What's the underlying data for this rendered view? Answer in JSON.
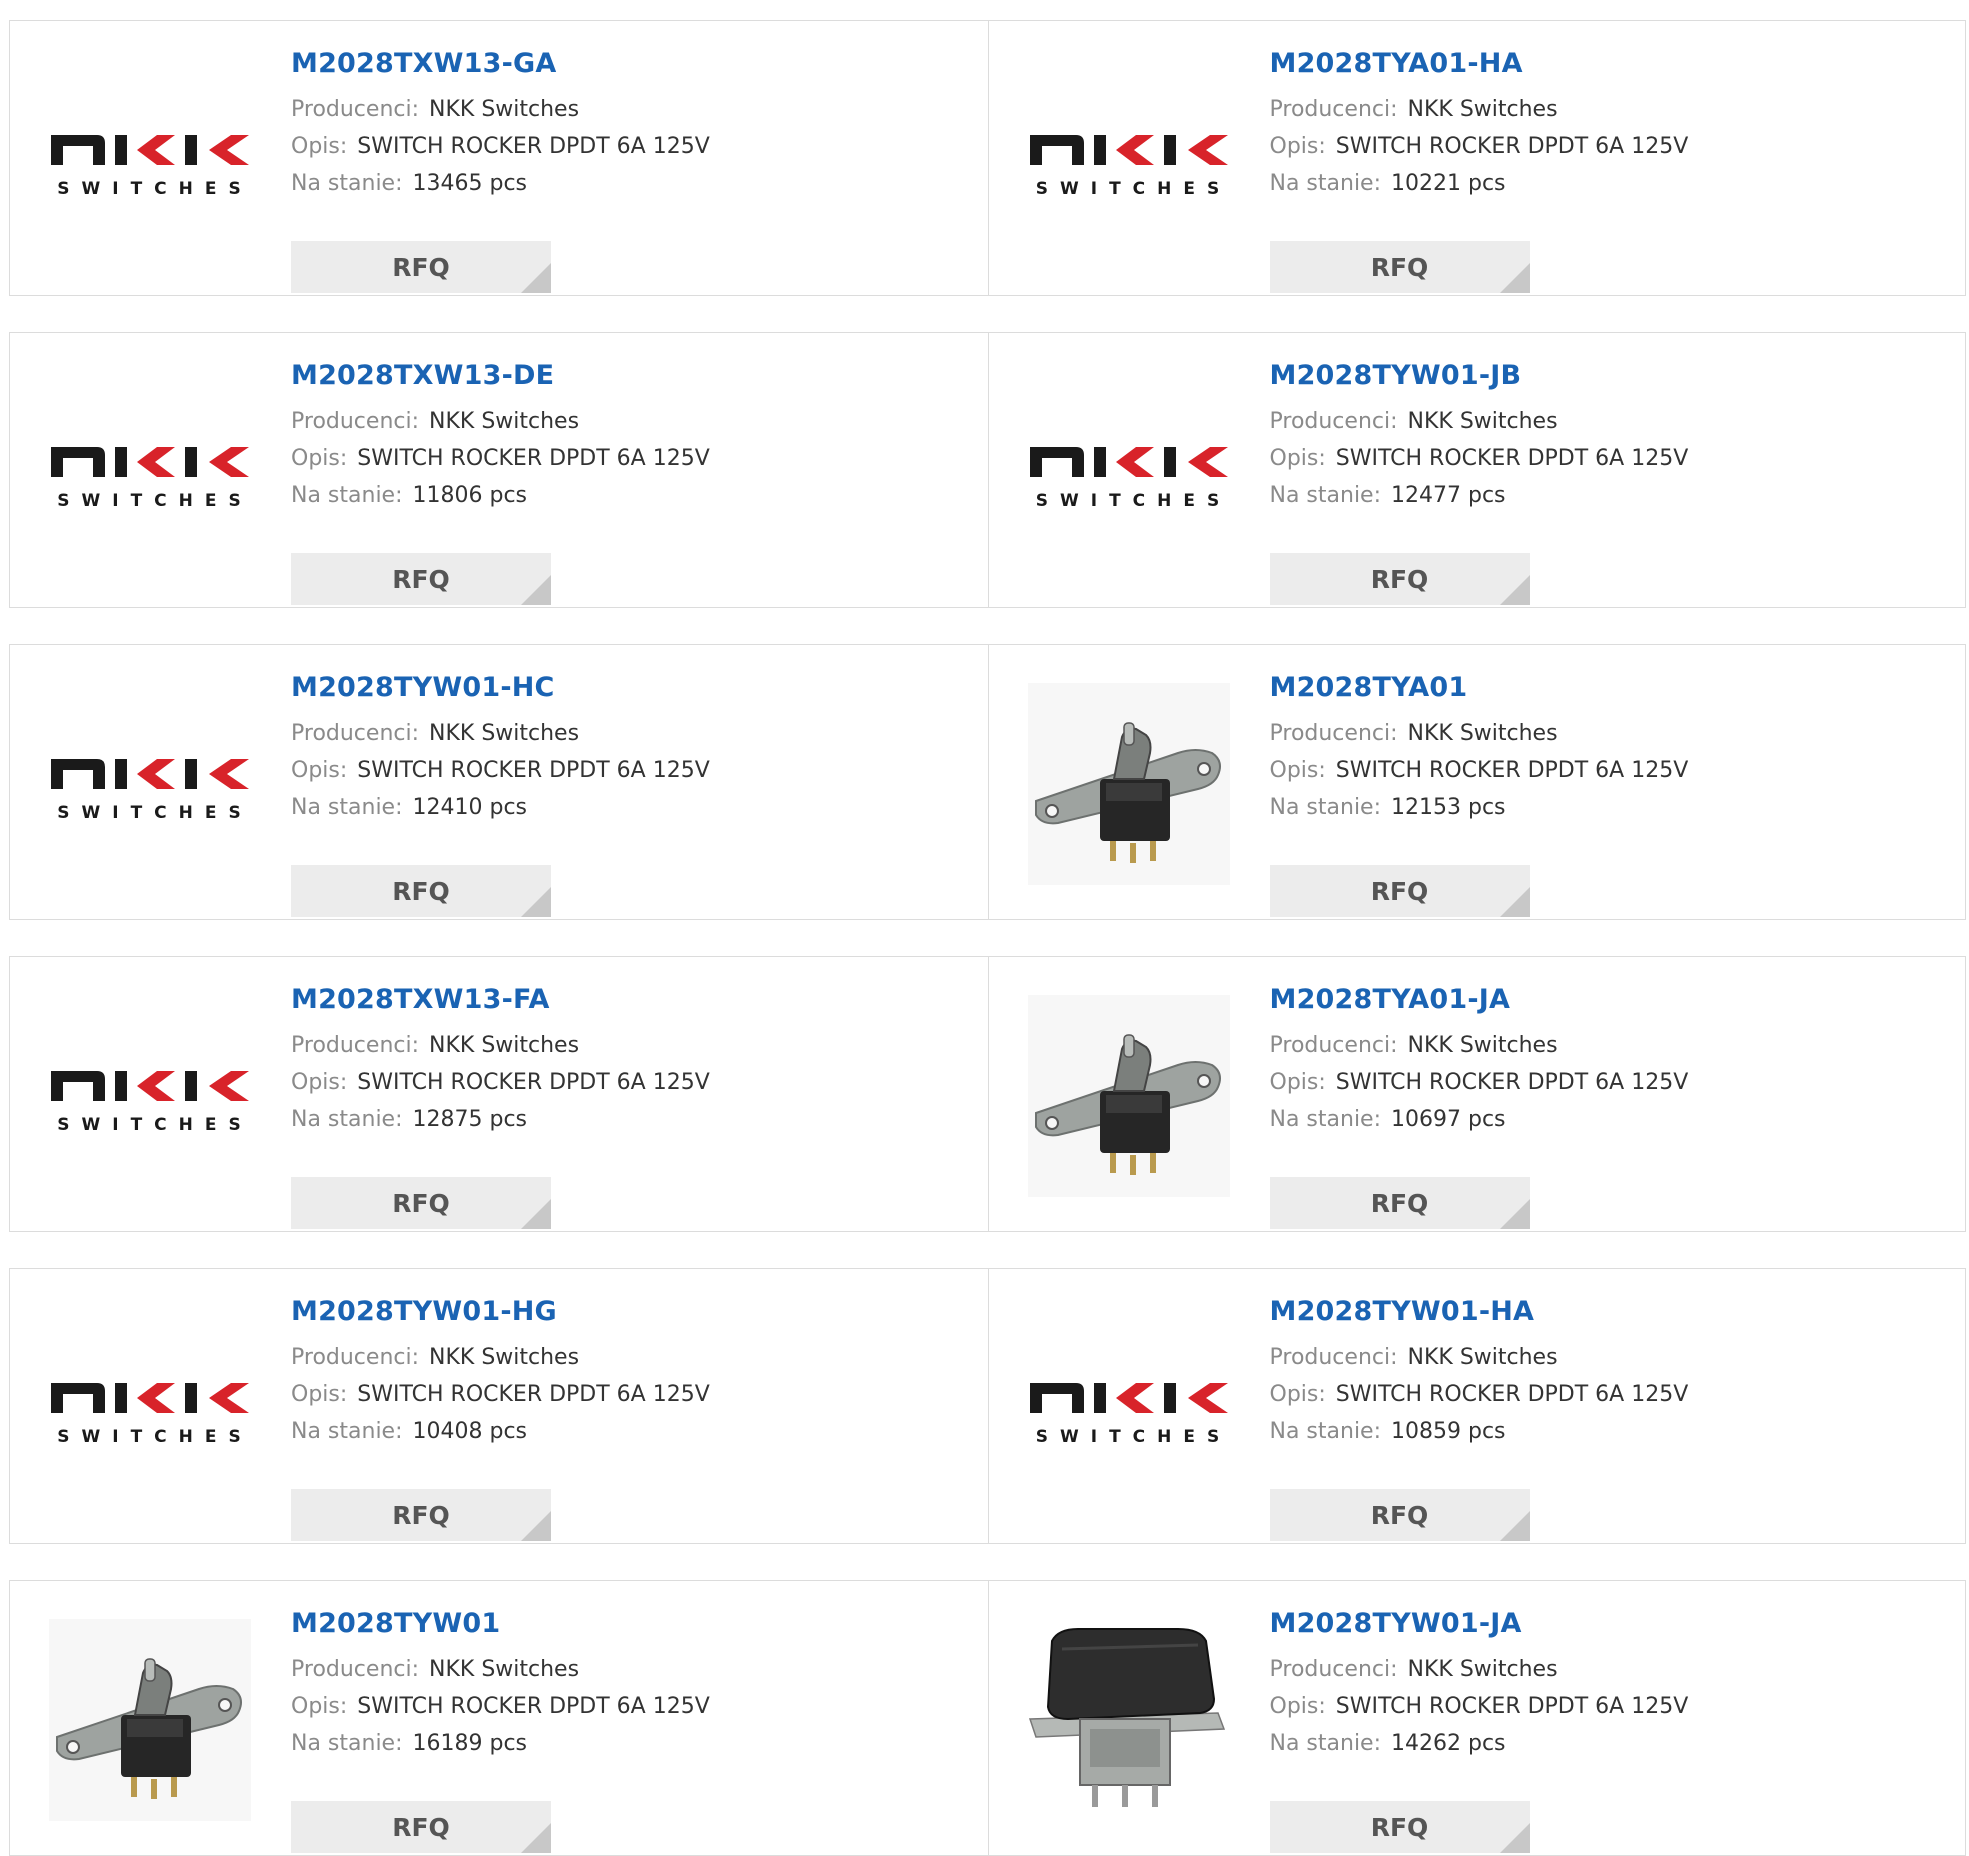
{
  "labels": {
    "manufacturer": "Producenci:",
    "description": "Opis:",
    "stock": "Na stanie:",
    "rfq": "RFQ"
  },
  "logo": {
    "main": "NKK",
    "sub": "SWITCHES",
    "colors": {
      "dark": "#1a1a1a",
      "red": "#d8232a"
    }
  },
  "colors": {
    "link": "#1a63b3",
    "border": "#dcdcdc",
    "button_bg": "#ececec"
  },
  "products": [
    {
      "pn": "M2028TXW13-GA",
      "manufacturer": "NKK Switches",
      "description": "SWITCH ROCKER DPDT 6A 125V",
      "stock": "13465 pcs",
      "image": "nkk-logo"
    },
    {
      "pn": "M2028TYA01-HA",
      "manufacturer": "NKK Switches",
      "description": "SWITCH ROCKER DPDT 6A 125V",
      "stock": "10221 pcs",
      "image": "nkk-logo"
    },
    {
      "pn": "M2028TXW13-DE",
      "manufacturer": "NKK Switches",
      "description": "SWITCH ROCKER DPDT 6A 125V",
      "stock": "11806 pcs",
      "image": "nkk-logo"
    },
    {
      "pn": "M2028TYW01-JB",
      "manufacturer": "NKK Switches",
      "description": "SWITCH ROCKER DPDT 6A 125V",
      "stock": "12477 pcs",
      "image": "nkk-logo"
    },
    {
      "pn": "M2028TYW01-HC",
      "manufacturer": "NKK Switches",
      "description": "SWITCH ROCKER DPDT 6A 125V",
      "stock": "12410 pcs",
      "image": "nkk-logo"
    },
    {
      "pn": "M2028TYA01",
      "manufacturer": "NKK Switches",
      "description": "SWITCH ROCKER DPDT 6A 125V",
      "stock": "12153 pcs",
      "image": "switch-photo"
    },
    {
      "pn": "M2028TXW13-FA",
      "manufacturer": "NKK Switches",
      "description": "SWITCH ROCKER DPDT 6A 125V",
      "stock": "12875 pcs",
      "image": "nkk-logo"
    },
    {
      "pn": "M2028TYA01-JA",
      "manufacturer": "NKK Switches",
      "description": "SWITCH ROCKER DPDT 6A 125V",
      "stock": "10697 pcs",
      "image": "switch-photo"
    },
    {
      "pn": "M2028TYW01-HG",
      "manufacturer": "NKK Switches",
      "description": "SWITCH ROCKER DPDT 6A 125V",
      "stock": "10408 pcs",
      "image": "nkk-logo"
    },
    {
      "pn": "M2028TYW01-HA",
      "manufacturer": "NKK Switches",
      "description": "SWITCH ROCKER DPDT 6A 125V",
      "stock": "10859 pcs",
      "image": "nkk-logo"
    },
    {
      "pn": "M2028TYW01",
      "manufacturer": "NKK Switches",
      "description": "SWITCH ROCKER DPDT 6A 125V",
      "stock": "16189 pcs",
      "image": "switch-photo"
    },
    {
      "pn": "M2028TYW01-JA",
      "manufacturer": "NKK Switches",
      "description": "SWITCH ROCKER DPDT 6A 125V",
      "stock": "14262 pcs",
      "image": "rocker-photo"
    }
  ]
}
